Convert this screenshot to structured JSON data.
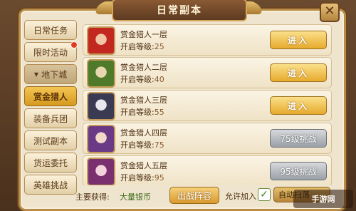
{
  "window": {
    "title": "日常副本",
    "close_label": "✕"
  },
  "sidebar": {
    "items": [
      {
        "label": "日常任务",
        "state": "normal"
      },
      {
        "label": "限时活动",
        "state": "normal",
        "badge": true
      },
      {
        "label": "地下城",
        "state": "group"
      },
      {
        "label": "赏金猎人",
        "state": "active"
      },
      {
        "label": "装备兵团",
        "state": "normal"
      },
      {
        "label": "测试副本",
        "state": "normal"
      },
      {
        "label": "货运委托",
        "state": "normal"
      },
      {
        "label": "英雄挑战",
        "state": "normal"
      }
    ]
  },
  "levels": {
    "level_prefix": "开启等级:",
    "rows": [
      {
        "name": "赏金猎人一层",
        "level": "25",
        "button": "进入",
        "status": "open"
      },
      {
        "name": "赏金猎人二层",
        "level": "40",
        "button": "进入",
        "status": "open"
      },
      {
        "name": "赏金猎人三层",
        "level": "55",
        "button": "进入",
        "status": "open"
      },
      {
        "name": "赏金猎人四层",
        "level": "75",
        "button": "75级挑战",
        "status": "locked"
      },
      {
        "name": "赏金猎人五层",
        "level": "95",
        "button": "95级挑战",
        "status": "locked"
      }
    ]
  },
  "footer": {
    "reward_label": "主要获得:",
    "reward_value": "大量银币",
    "lineup_button": "出战阵容",
    "allow_label": "允许加入",
    "allow_checked": true,
    "auto_button": "自动扫荡"
  },
  "watermark": {
    "text": "手游网"
  },
  "colors": {
    "accent": "#e6aa2d",
    "panel": "#efe5cf",
    "border": "#b98b47",
    "locked": "#9aa0a7"
  }
}
